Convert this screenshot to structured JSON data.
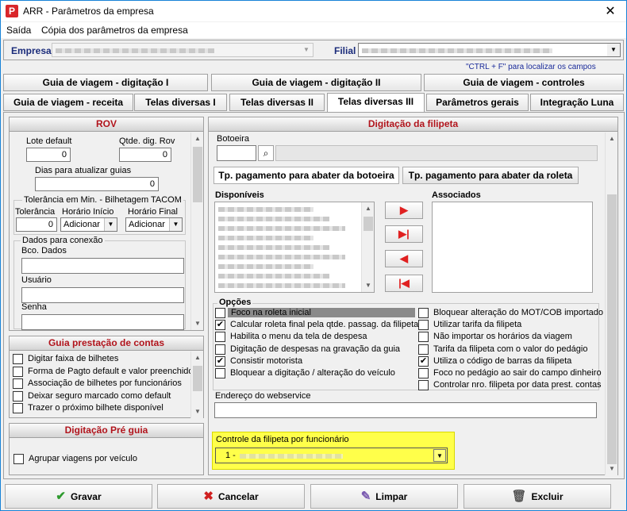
{
  "window": {
    "title": "ARR - Parâmetros da empresa",
    "icon_letter": "P"
  },
  "menu": [
    "Saída",
    "Cópia dos parâmetros da empresa"
  ],
  "header": {
    "empresa_label": "Empresa",
    "filial_label": "Filial",
    "hint": "\"CTRL + F\" para localizar os campos"
  },
  "tabs_row1": [
    "Guia de viagem - digitação I",
    "Guia de viagem - digitação II",
    "Guia de viagem - controles"
  ],
  "tabs_row2": [
    "Guia de viagem - receita",
    "Telas diversas I",
    "Telas diversas II",
    "Telas diversas III",
    "Parâmetros gerais",
    "Integração Luna"
  ],
  "rov": {
    "title": "ROV",
    "lote_default_label": "Lote default",
    "lote_default_value": "0",
    "qtde_dig_label": "Qtde. dig. Rov",
    "qtde_dig_value": "0",
    "dias_label": "Dias para atualizar guias",
    "dias_value": "0",
    "tolerancia_group": "Tolerância em Min. - Bilhetagem TACOM",
    "tolerancia_label": "Tolerância",
    "tolerancia_value": "0",
    "horario_inicio_label": "Horário Início",
    "horario_inicio_value": "Adicionar",
    "horario_final_label": "Horário Final",
    "horario_final_value": "Adicionar",
    "conexao_group": "Dados para conexão",
    "bco_dados_label": "Bco. Dados",
    "usuario_label": "Usuário",
    "senha_label": "Senha"
  },
  "prestacao": {
    "title": "Guia prestação de contas",
    "items": [
      {
        "label": "Digitar faixa de bilhetes",
        "checked": false
      },
      {
        "label": "Forma de Pagto default e valor preenchido",
        "checked": false
      },
      {
        "label": "Associação de bilhetes por funcionários",
        "checked": false
      },
      {
        "label": "Deixar seguro marcado como default",
        "checked": false
      },
      {
        "label": "Trazer o próximo bilhete disponível",
        "checked": false
      }
    ]
  },
  "pre_guia": {
    "title": "Digitação Pré guia",
    "agrupar_label": "Agrupar viagens por veículo"
  },
  "filipeta": {
    "title": "Digitação da filipeta",
    "botoeira_label": "Botoeira",
    "tab_botoeira": "Tp. pagamento para abater da botoeira",
    "tab_roleta": "Tp. pagamento para abater da roleta",
    "disponiveis_label": "Disponíveis",
    "associados_label": "Associados",
    "arrows": [
      "▶",
      "▶|",
      "◀",
      "|◀"
    ],
    "opcoes_label": "Opções",
    "opcoes_left": [
      {
        "label": "Foco na roleta inicial",
        "checked": false
      },
      {
        "label": "Calcular roleta final pela qtde. passag. da filipeta",
        "checked": true
      },
      {
        "label": "Habilita o menu da tela de despesa",
        "checked": false
      },
      {
        "label": "Digitação de despesas na gravação da guia",
        "checked": false
      },
      {
        "label": "Consistir motorista",
        "checked": true
      },
      {
        "label": "Bloquear a digitação / alteração do veículo",
        "checked": false
      }
    ],
    "opcoes_right": [
      {
        "label": "Bloquear alteração do MOT/COB importado",
        "checked": false
      },
      {
        "label": "Utilizar tarifa da filipeta",
        "checked": false
      },
      {
        "label": "Não importar os horários da viagem",
        "checked": false
      },
      {
        "label": "Tarifa da filipeta com o valor do pedágio",
        "checked": false
      },
      {
        "label": "Utiliza o código de barras da filipeta",
        "checked": true
      },
      {
        "label": "Foco no pedágio ao sair do campo dinheiro",
        "checked": false
      },
      {
        "label": "Controlar nro. filipeta por data prest. contas",
        "checked": false
      }
    ],
    "endereco_label": "Endereço do webservice",
    "controle_label": "Controle da filipeta por funcionário",
    "controle_value": "1 -"
  },
  "footer": {
    "gravar": "Gravar",
    "cancelar": "Cancelar",
    "limpar": "Limpar",
    "excluir": "Excluir"
  },
  "colors": {
    "accent_red": "#b1141c",
    "highlight_yellow": "#ffff4a",
    "selection_blue": "#1883d7"
  }
}
